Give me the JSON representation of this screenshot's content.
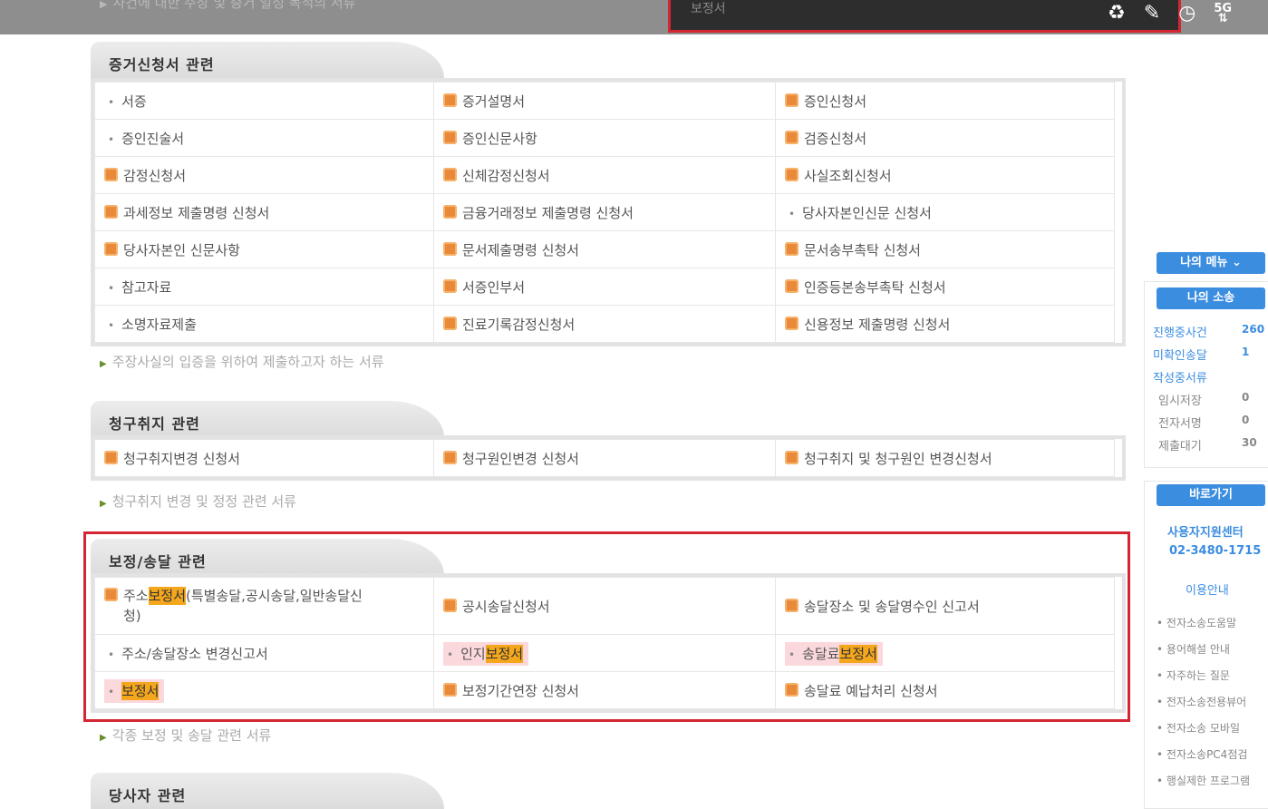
{
  "top": {
    "hint": "사건에 대한 주장 및 증거 일정 목적의 서류",
    "toast_text": "보정서",
    "icons": [
      "recycle-icon",
      "pen-icon",
      "clock-icon",
      "network-5g-icon"
    ],
    "network_label": "5G"
  },
  "sections": {
    "evidence": {
      "title": "증거신청서 관련",
      "rows": [
        [
          {
            "t": "서증",
            "icon": false
          },
          {
            "t": "증거설명서",
            "icon": true
          },
          {
            "t": "증인신청서",
            "icon": true
          }
        ],
        [
          {
            "t": "증인진술서",
            "icon": false
          },
          {
            "t": "증인신문사항",
            "icon": true
          },
          {
            "t": "검증신청서",
            "icon": true
          }
        ],
        [
          {
            "t": "감정신청서",
            "icon": true
          },
          {
            "t": "신체감정신청서",
            "icon": true
          },
          {
            "t": "사실조회신청서",
            "icon": true
          }
        ],
        [
          {
            "t": "과세정보 제출명령 신청서",
            "icon": true
          },
          {
            "t": "금융거래정보 제출명령 신청서",
            "icon": true
          },
          {
            "t": "당사자본인신문 신청서",
            "icon": false
          }
        ],
        [
          {
            "t": "당사자본인 신문사항",
            "icon": true
          },
          {
            "t": "문서제출명령 신청서",
            "icon": true
          },
          {
            "t": "문서송부촉탁 신청서",
            "icon": true
          }
        ],
        [
          {
            "t": "참고자료",
            "icon": false
          },
          {
            "t": "서증인부서",
            "icon": true
          },
          {
            "t": "인증등본송부촉탁 신청서",
            "icon": true
          }
        ],
        [
          {
            "t": "소명자료제출",
            "icon": false
          },
          {
            "t": "진료기록감정신청서",
            "icon": true
          },
          {
            "t": "신용정보 제출명령 신청서",
            "icon": true
          }
        ]
      ],
      "note": "주장사실의 입증을 위하여 제출하고자 하는 서류"
    },
    "claim": {
      "title": "청구취지 관련",
      "rows": [
        [
          {
            "t": "청구취지변경 신청서",
            "icon": true
          },
          {
            "t": "청구원인변경 신청서",
            "icon": true
          },
          {
            "t": "청구취지 및 청구원인 변경신청서",
            "icon": true
          }
        ]
      ],
      "note": "청구취지 변경 및 정정 관련 서류"
    },
    "correction": {
      "title": "보정/송달 관련",
      "r1c1_a": "주소",
      "r1c1_hl": "보정서",
      "r1c1_b": "(특별송달,공시송달,일반송달신",
      "r1c1_c": "청)",
      "r1c2": "공시송달신청서",
      "r1c3": "송달장소 및 송달영수인 신고서",
      "r2c1": "주소/송달장소 변경신고서",
      "r2c2_a": "인지",
      "r2c2_hl": "보정서",
      "r2c3_a": "송달료",
      "r2c3_hl": "보정서",
      "r3c1_hl": "보정서",
      "r3c2": "보정기간연장 신청서",
      "r3c3": "송달료 예납처리 신청서",
      "note": "각종 보정 및 송달 관련 서류"
    },
    "party": {
      "title": "당사자 관련"
    }
  },
  "sidebar": {
    "my_menu": "나의 메뉴",
    "my_case": "나의 소송",
    "stats": [
      {
        "label": "진행중사건",
        "value": "260",
        "color": "#3b8de0"
      },
      {
        "label": "미확인송달",
        "value": "1",
        "color": "#3b8de0"
      },
      {
        "label": "작성중서류",
        "value": "",
        "color": "#3b8de0"
      },
      {
        "label": "임시저장",
        "value": "0",
        "color": "#888"
      },
      {
        "label": "전자서명",
        "value": "0",
        "color": "#888"
      },
      {
        "label": "제출대기",
        "value": "30",
        "color": "#888"
      }
    ],
    "shortcut": "바로가기",
    "center_name": "사용자지원센터",
    "center_phone": "02-3480-1715",
    "guide": "이용안내",
    "links": [
      "전자소송도움말",
      "용어해설 안내",
      "자주하는 질문",
      "전자소송전용뷰어",
      "전자소송 모바일",
      "전자소송PC4점검",
      "행실제한 프로그램"
    ]
  }
}
